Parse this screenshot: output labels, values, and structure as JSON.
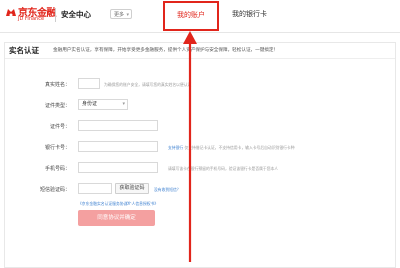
{
  "header": {
    "logo_cn": "京东金融",
    "logo_en": "JD Finance",
    "site_title": "安全中心",
    "more_label": "更多",
    "tabs": [
      {
        "label": "我的账户"
      },
      {
        "label": "我的银行卡"
      }
    ]
  },
  "panel": {
    "title": "实名认证",
    "desc": "金融用户实名认证，享有保障，开始享受更多金融服务，提供个人资产保护与安全保障，轻松认证，一键搞定！"
  },
  "form": {
    "real_name": {
      "label": "真实姓名：",
      "value": "",
      "hint": "为确保您的账户安全，请填写您的真实姓名以便认证"
    },
    "id_type": {
      "label": "证件类型：",
      "value": "身份证"
    },
    "id_number": {
      "label": "证件号：",
      "value": ""
    },
    "bank_card": {
      "label": "银行卡号：",
      "value": "",
      "hint_link": "支持银行",
      "hint": "仅支持借记卡认证，不支持信用卡，输入卡号后自动识别银行卡种"
    },
    "phone": {
      "label": "手机号码：",
      "value": "",
      "hint": "请填写该卡在银行预留的手机号码，验证该银行卡是否属于您本人"
    },
    "code": {
      "label": "短信验证码：",
      "value": "",
      "button": "获取验证码",
      "help": "没有收到短信？"
    }
  },
  "agreements": [
    "《京东金融实名认证服务协议》",
    "《个人信息授权书》"
  ],
  "submit_label": "同意协议并确定",
  "colors": {
    "brand_red": "#e1251b",
    "link_blue": "#3b7fd0",
    "submit_bg": "#f4a0a0"
  }
}
